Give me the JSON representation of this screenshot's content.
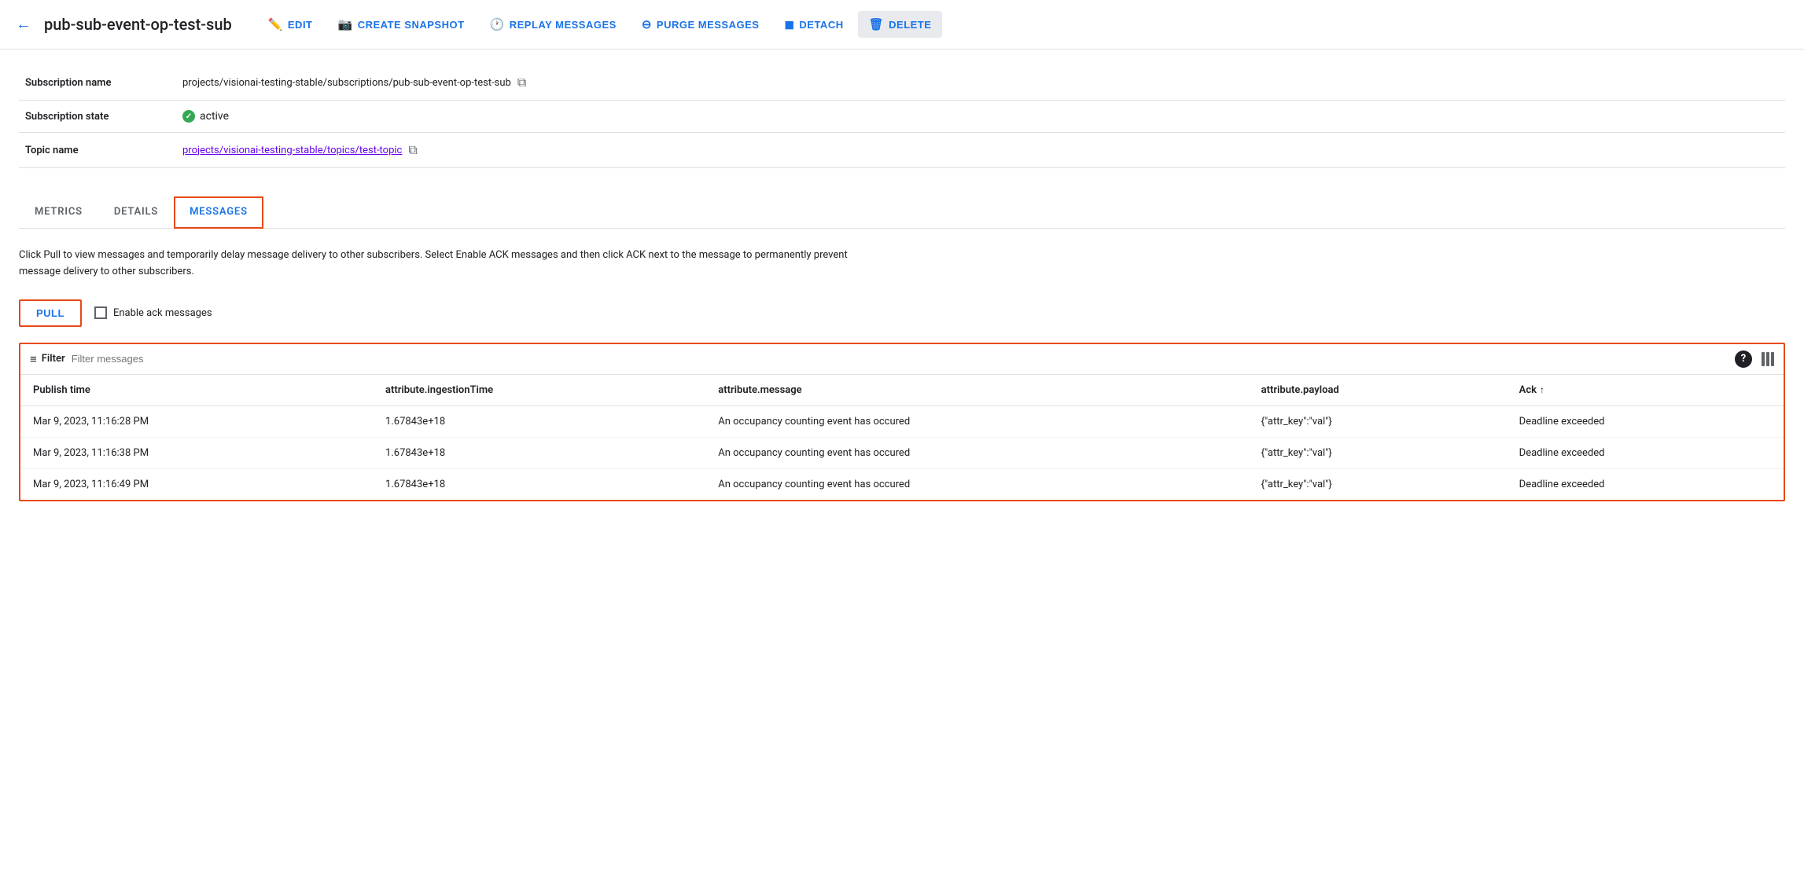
{
  "header": {
    "back_label": "←",
    "title": "pub-sub-event-op-test-sub",
    "actions": [
      {
        "id": "edit",
        "label": "EDIT",
        "icon": "pencil"
      },
      {
        "id": "create-snapshot",
        "label": "CREATE SNAPSHOT",
        "icon": "camera"
      },
      {
        "id": "replay-messages",
        "label": "REPLAY MESSAGES",
        "icon": "clock"
      },
      {
        "id": "purge-messages",
        "label": "PURGE MESSAGES",
        "icon": "circle-minus"
      },
      {
        "id": "detach",
        "label": "DETACH",
        "icon": "square"
      },
      {
        "id": "delete",
        "label": "DELETE",
        "icon": "trash"
      }
    ]
  },
  "info": {
    "rows": [
      {
        "label": "Subscription name",
        "value": "projects/visionai-testing-stable/subscriptions/pub-sub-event-op-test-sub",
        "copyable": true,
        "is_link": false
      },
      {
        "label": "Subscription state",
        "value": "active",
        "is_status": true
      },
      {
        "label": "Topic name",
        "value": "projects/visionai-testing-stable/topics/test-topic",
        "copyable": true,
        "is_link": true
      }
    ]
  },
  "tabs": [
    {
      "id": "metrics",
      "label": "METRICS",
      "active": false
    },
    {
      "id": "details",
      "label": "DETAILS",
      "active": false
    },
    {
      "id": "messages",
      "label": "MESSAGES",
      "active": true
    }
  ],
  "messages_tab": {
    "description": "Click Pull to view messages and temporarily delay message delivery to other subscribers. Select Enable ACK messages and then click ACK next to the message to permanently prevent message delivery to other subscribers.",
    "pull_button_label": "PULL",
    "enable_ack_label": "Enable ack messages",
    "filter": {
      "label": "Filter",
      "placeholder": "Filter messages"
    },
    "table": {
      "columns": [
        {
          "id": "publish_time",
          "label": "Publish time"
        },
        {
          "id": "ingestion_time",
          "label": "attribute.ingestionTime"
        },
        {
          "id": "message",
          "label": "attribute.message"
        },
        {
          "id": "payload",
          "label": "attribute.payload"
        },
        {
          "id": "ack",
          "label": "Ack",
          "sortable": true
        }
      ],
      "rows": [
        {
          "publish_time": "Mar 9, 2023, 11:16:28 PM",
          "ingestion_time": "1.67843e+18",
          "message": "An occupancy counting event has occured",
          "payload": "{\"attr_key\":\"val\"}",
          "ack": "Deadline exceeded"
        },
        {
          "publish_time": "Mar 9, 2023, 11:16:38 PM",
          "ingestion_time": "1.67843e+18",
          "message": "An occupancy counting event has occured",
          "payload": "{\"attr_key\":\"val\"}",
          "ack": "Deadline exceeded"
        },
        {
          "publish_time": "Mar 9, 2023, 11:16:49 PM",
          "ingestion_time": "1.67843e+18",
          "message": "An occupancy counting event has occured",
          "payload": "{\"attr_key\":\"val\"}",
          "ack": "Deadline exceeded"
        }
      ]
    }
  }
}
